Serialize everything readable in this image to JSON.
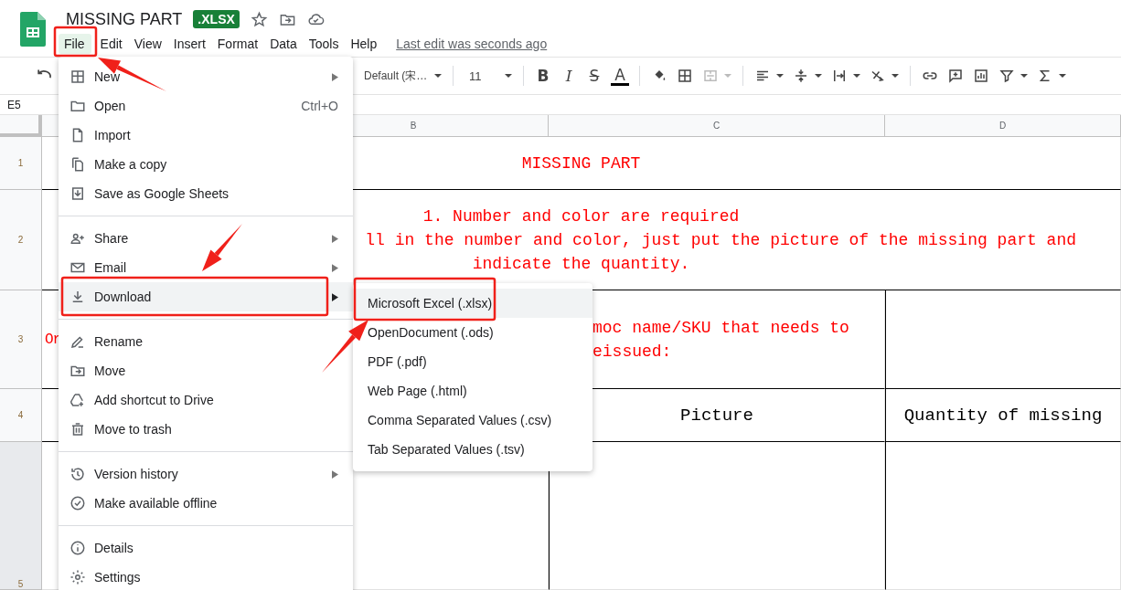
{
  "document": {
    "title": "MISSING PART",
    "format_badge": ".XLSX",
    "last_edit": "Last edit was seconds ago"
  },
  "menubar": [
    {
      "label": "File",
      "selected": true
    },
    {
      "label": "Edit",
      "selected": false
    },
    {
      "label": "View",
      "selected": false
    },
    {
      "label": "Insert",
      "selected": false
    },
    {
      "label": "Format",
      "selected": false
    },
    {
      "label": "Data",
      "selected": false
    },
    {
      "label": "Tools",
      "selected": false
    },
    {
      "label": "Help",
      "selected": false
    }
  ],
  "toolbar": {
    "font": "Default (宋…",
    "font_size": "11",
    "text_format_buttons": [
      {
        "label": "B",
        "kind": "bold"
      },
      {
        "label": "I",
        "kind": "italic"
      },
      {
        "label": "S",
        "kind": "strikethrough"
      },
      {
        "label": "A",
        "kind": "color"
      }
    ]
  },
  "name_box": "E5",
  "sheet": {
    "columns": [
      "B",
      "C",
      "D"
    ],
    "row_numbers": [
      "1",
      "2",
      "3",
      "4",
      "5"
    ],
    "title_cell": "MISSING PART",
    "note_lines": [
      "1. Number and color are required",
      "ll in the number and color, just put the picture of the missing part and",
      "indicate the quantity."
    ],
    "row_3": {
      "column_a": "Or",
      "column_c_lines": [
        "moc name/SKU that needs to",
        "eissued:"
      ]
    },
    "row_4": {
      "column_c": "Picture",
      "column_d": "Quantity of missing"
    }
  },
  "file_menu": {
    "sections": [
      {
        "items": [
          {
            "label": "New",
            "submenu": true,
            "selected": false
          },
          {
            "label": "Open",
            "shortcut": "Ctrl+O",
            "submenu": false,
            "selected": false
          },
          {
            "label": "Import",
            "submenu": false,
            "selected": false
          },
          {
            "label": "Make a copy",
            "submenu": false,
            "selected": false
          },
          {
            "label": "Save as Google Sheets",
            "submenu": false,
            "selected": false
          }
        ]
      },
      {
        "items": [
          {
            "label": "Share",
            "submenu": true,
            "selected": false
          },
          {
            "label": "Email",
            "submenu": true,
            "selected": false
          },
          {
            "label": "Download",
            "submenu": true,
            "selected": true
          }
        ]
      },
      {
        "items": [
          {
            "label": "Rename",
            "submenu": false,
            "selected": false
          },
          {
            "label": "Move",
            "submenu": false,
            "selected": false
          },
          {
            "label": "Add shortcut to Drive",
            "submenu": false,
            "selected": false
          },
          {
            "label": "Move to trash",
            "submenu": false,
            "selected": false
          }
        ]
      },
      {
        "items": [
          {
            "label": "Version history",
            "submenu": true,
            "selected": false
          },
          {
            "label": "Make available offline",
            "submenu": false,
            "selected": false
          }
        ]
      },
      {
        "items": [
          {
            "label": "Details",
            "submenu": false,
            "selected": false
          },
          {
            "label": "Settings",
            "submenu": false,
            "selected": false
          }
        ]
      }
    ]
  },
  "download_submenu": [
    {
      "label": "Microsoft Excel (.xlsx)",
      "selected": true
    },
    {
      "label": "OpenDocument (.ods)",
      "selected": false
    },
    {
      "label": "PDF (.pdf)",
      "selected": false
    },
    {
      "label": "Web Page (.html)",
      "selected": false
    },
    {
      "label": "Comma Separated Values (.csv)",
      "selected": false
    },
    {
      "label": "Tab Separated Values (.tsv)",
      "selected": false
    }
  ]
}
